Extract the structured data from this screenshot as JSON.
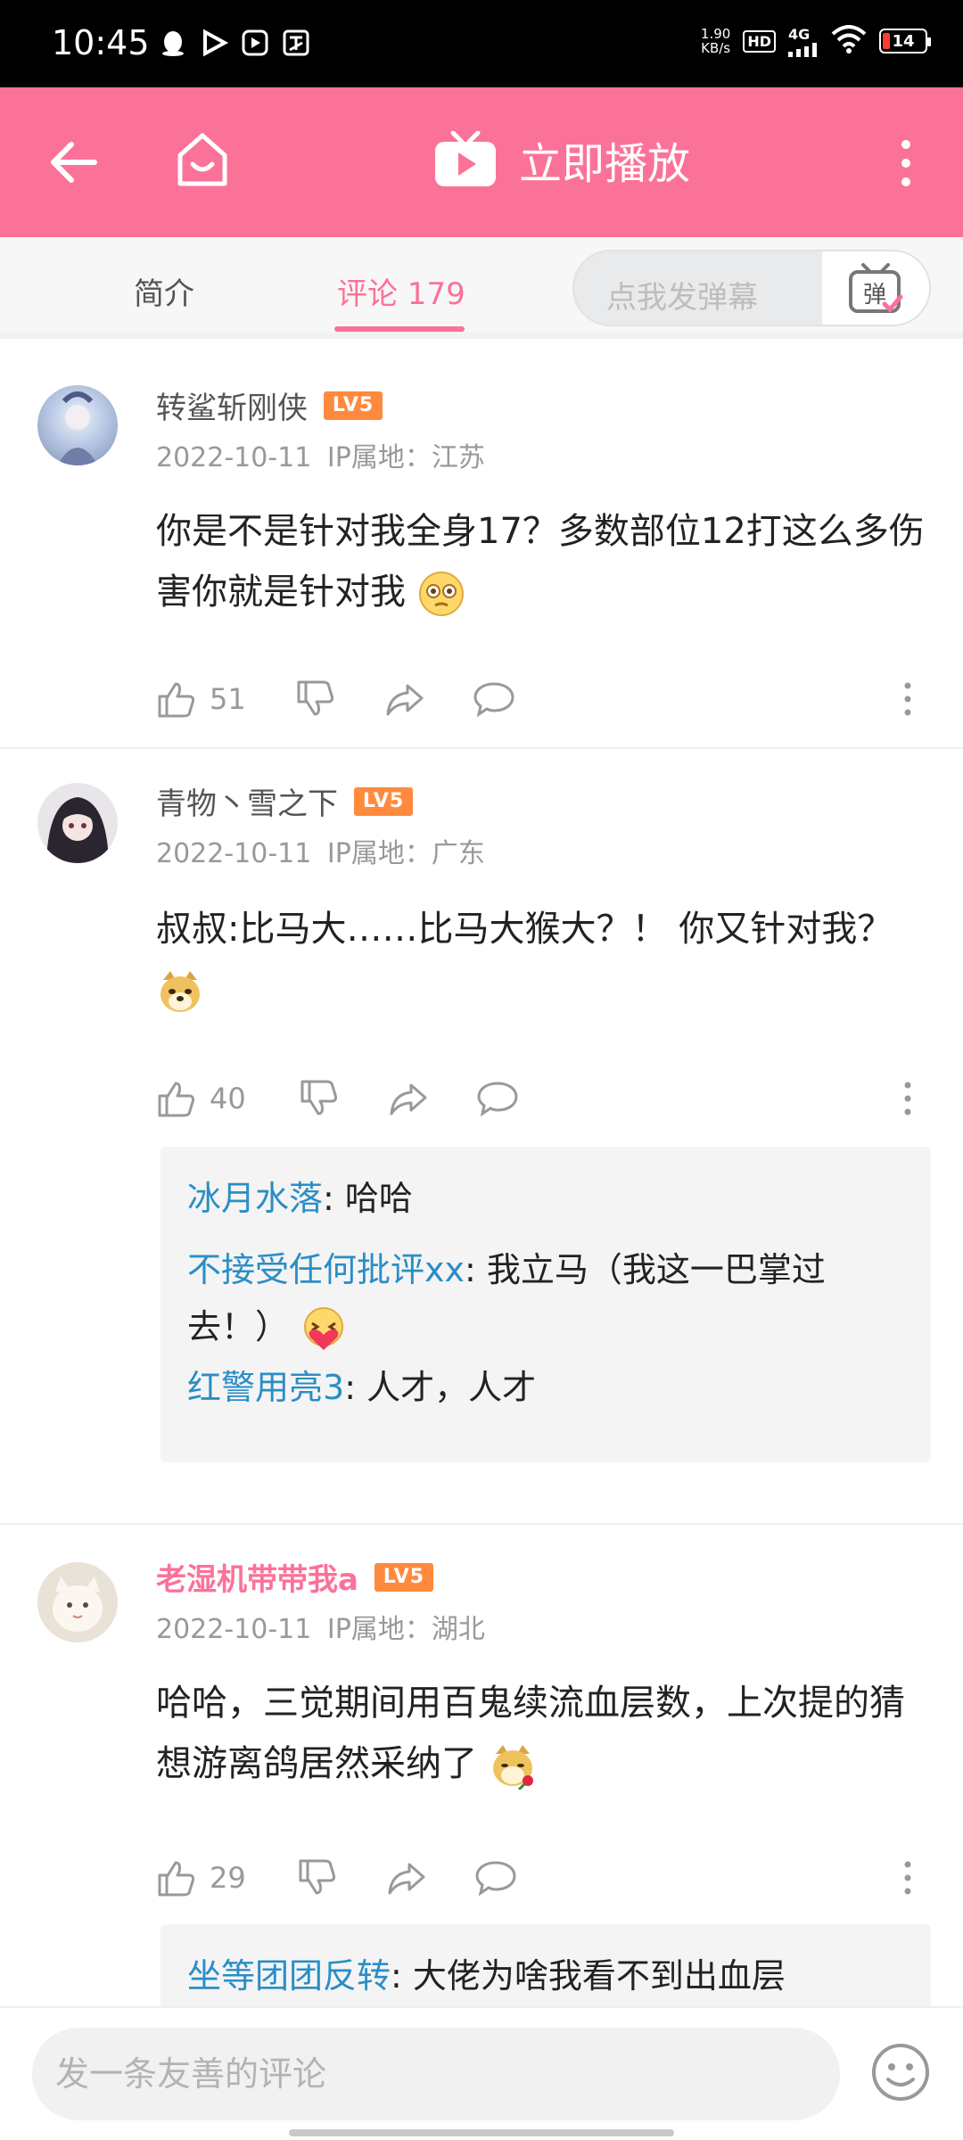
{
  "status_bar": {
    "time": "10:45",
    "speed_value": "1.90",
    "speed_unit": "KB/s",
    "hd": "HD",
    "network": "4G",
    "battery": "14"
  },
  "header": {
    "play_label": "立即播放"
  },
  "tabs": [
    {
      "label": "简介"
    },
    {
      "label": "评论 179"
    }
  ],
  "danmaku": {
    "placeholder": "点我发弹幕",
    "button_label": "弹"
  },
  "comments": [
    {
      "username": "转鲨斩刚侠",
      "level": "LV5",
      "date": "2022-10-11",
      "ip": "IP属地：江苏",
      "text": "你是不是针对我全身17？多数部位12打这么多伤害你就是针对我",
      "likes": "51"
    },
    {
      "username": "青物丶雪之下",
      "level": "LV5",
      "date": "2022-10-11",
      "ip": "IP属地：广东",
      "text": "叔叔:比马大……比马大猴大？！ 你又针对我？",
      "likes": "40",
      "replies": [
        {
          "name": "冰月水落",
          "text": ": 哈哈"
        },
        {
          "name": "不接受任何批评xx",
          "text": ": 我立马（我这一巴掌过去！）"
        },
        {
          "name": "红警用亮3",
          "text": ": 人才，人才"
        }
      ]
    },
    {
      "username": "老湿机带带我a",
      "level": "LV5",
      "date": "2022-10-11",
      "ip": "IP属地：湖北",
      "text": "哈哈，三觉期间用百鬼续流血层数，上次提的猜想游离鸽居然采纳了",
      "likes": "29",
      "replies": [
        {
          "name": "坐等团团反转",
          "text": ": 大佬为啥我看不到出血层"
        }
      ]
    }
  ],
  "bottom": {
    "input_placeholder": "发一条友善的评论"
  },
  "colors": {
    "brand_pink": "#fb7299",
    "reply_blue": "#2a8ec6",
    "level_orange": "#ff8a3d"
  },
  "icons": [
    "back-icon",
    "home-icon",
    "tv-icon",
    "more-icon",
    "like-icon",
    "dislike-icon",
    "share-icon",
    "reply-icon",
    "emoji-icon"
  ]
}
